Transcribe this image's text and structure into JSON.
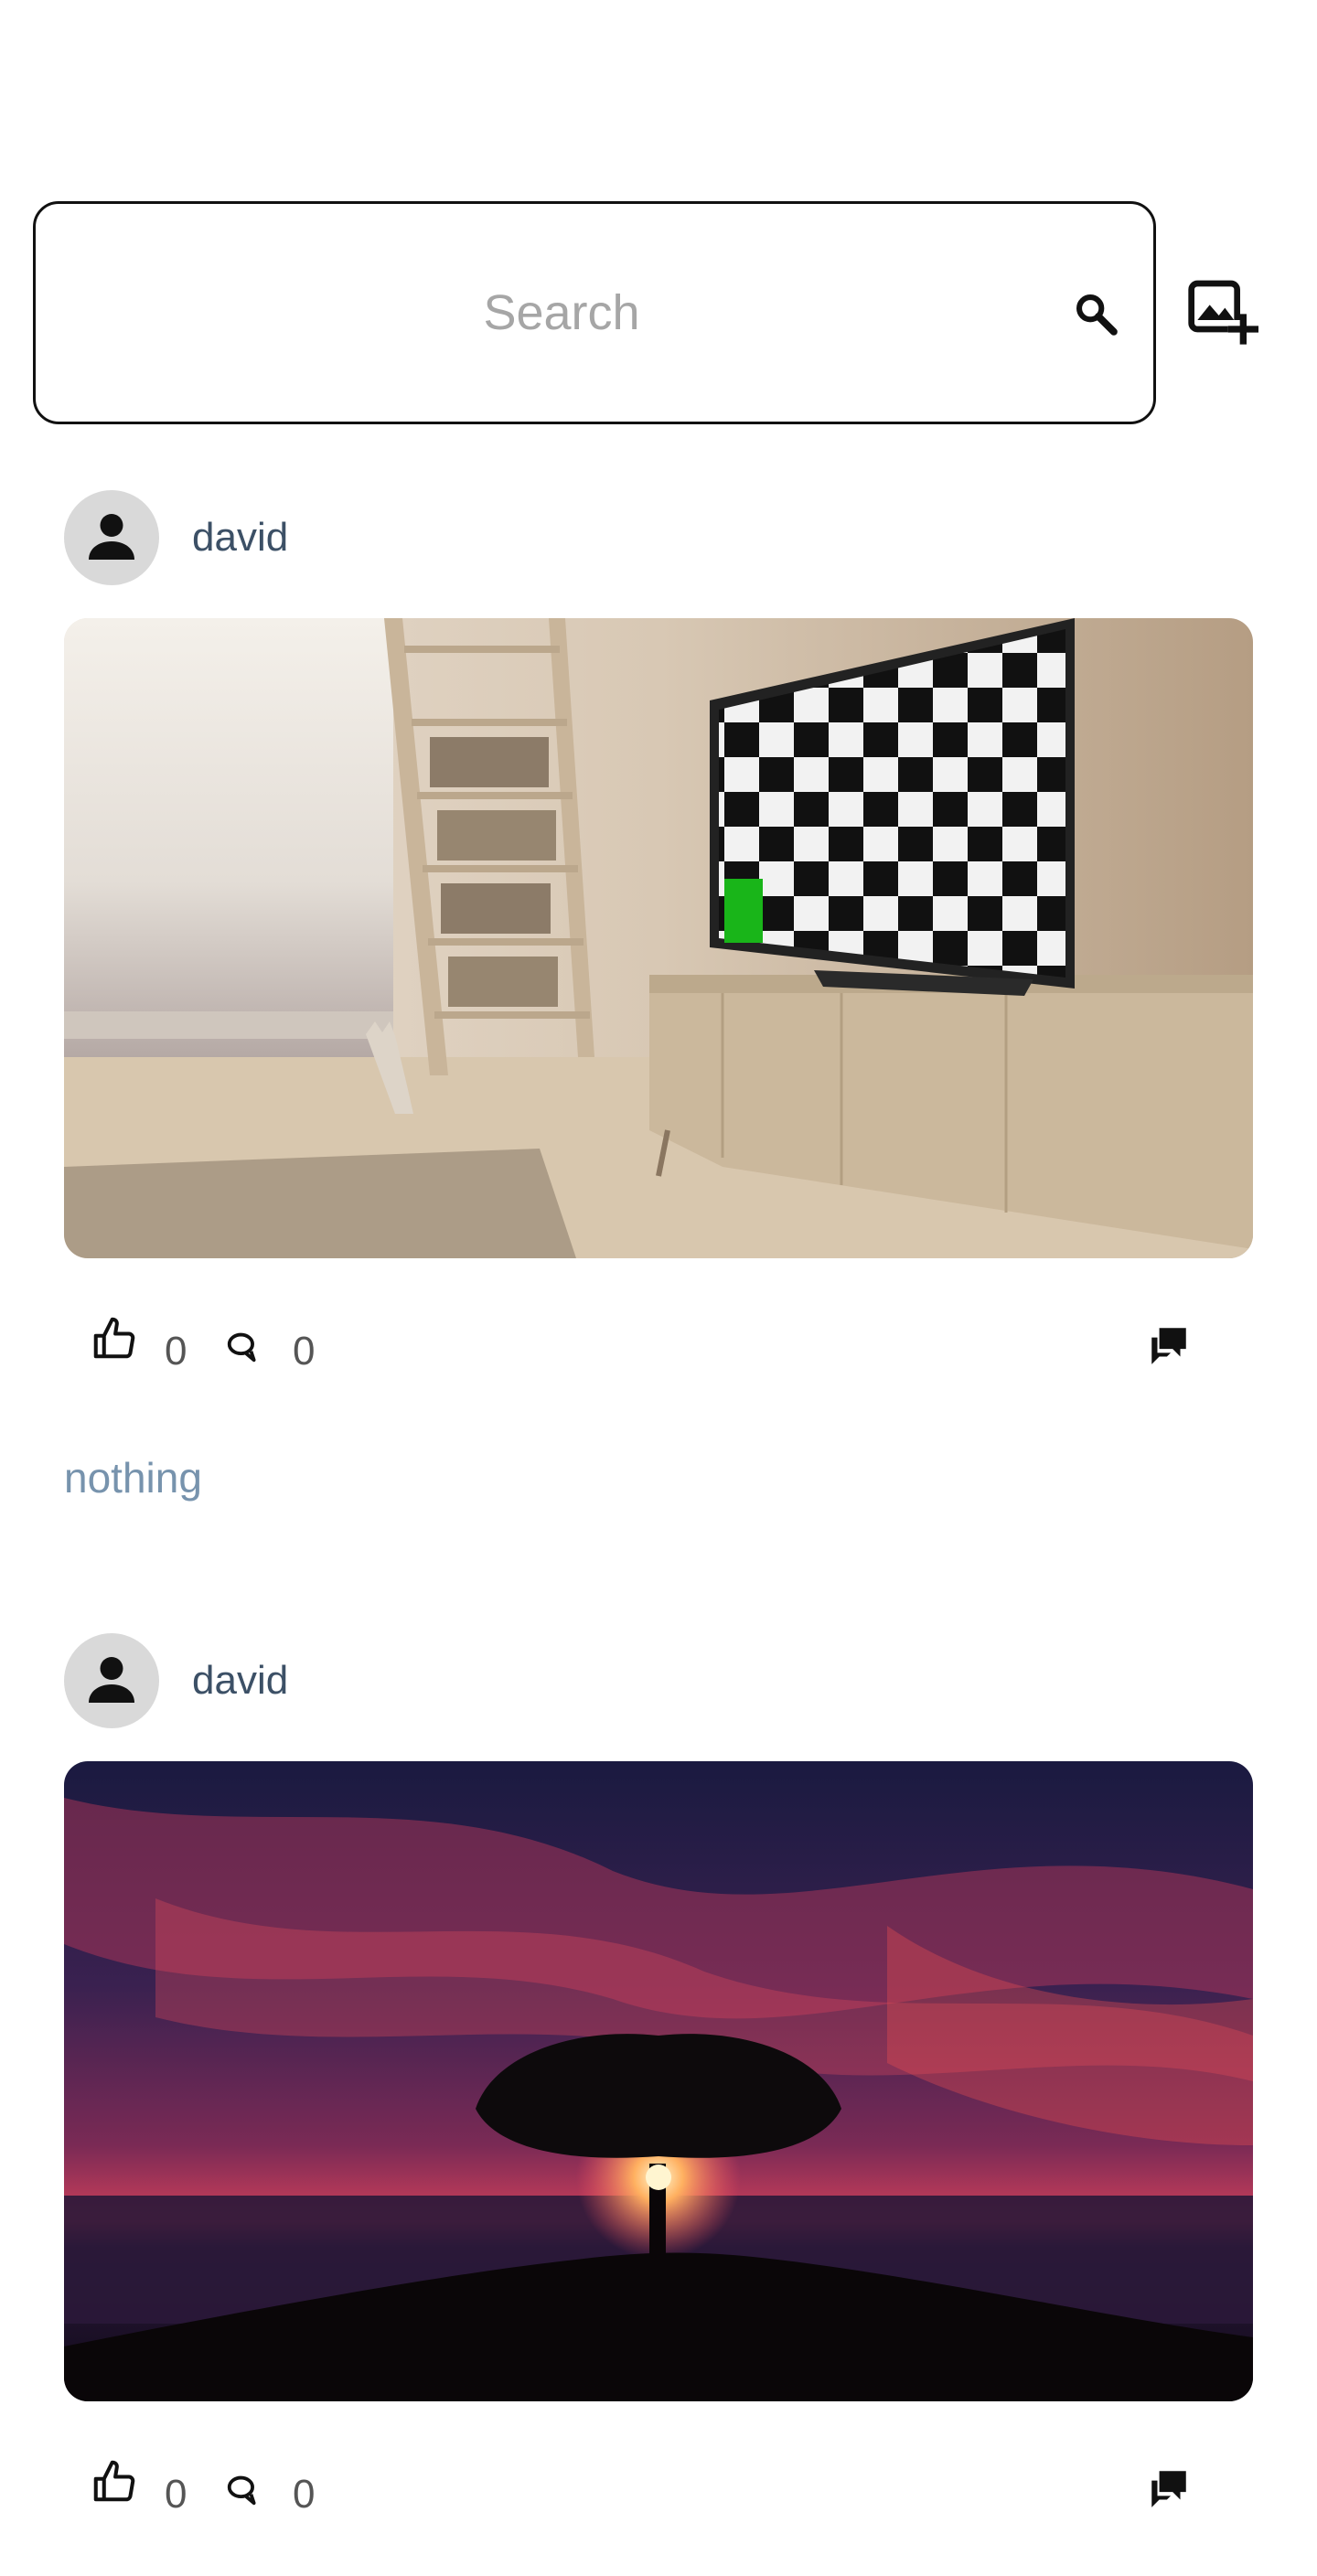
{
  "search": {
    "placeholder": "Search"
  },
  "icons": {
    "search": "search-icon",
    "add_photo": "add-photo-icon",
    "avatar": "person-icon",
    "like": "thumbs-up-icon",
    "comment": "comment-bubble-icon",
    "chat": "chat-bubbles-icon"
  },
  "posts": [
    {
      "author": "david",
      "image": "living room with cat and TV showing checkerboard",
      "likes": "0",
      "comments": "0",
      "caption": "nothing"
    },
    {
      "author": "david",
      "image": "tree silhouette at sunset over the sea",
      "likes": "0",
      "comments": "0",
      "caption": ""
    }
  ],
  "colors": {
    "author": "#3c5066",
    "caption": "#7793ad",
    "counts": "#555555",
    "avatar_bg": "#d9d9d9",
    "border": "#111111"
  }
}
